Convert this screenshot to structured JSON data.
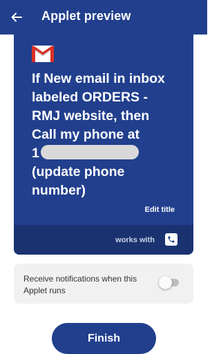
{
  "header": {
    "title": "Applet preview",
    "back_icon": "arrow-left-icon"
  },
  "card": {
    "service_icon": "gmail-icon",
    "title_lines": [
      "If New email in inbox",
      "labeled ORDERS -",
      "RMJ website, then",
      "Call my phone at",
      "1",
      "(update phone",
      "number)"
    ],
    "edit_title": "Edit title",
    "works_with": "works with",
    "works_with_icon": "phone-icon"
  },
  "notification": {
    "text": "Receive notifications when this Applet runs",
    "toggle_on": false
  },
  "finish_button": "Finish",
  "colors": {
    "primary": "#213f8d",
    "card_footer": "#1a3370",
    "notification_bg": "#f1f1f1"
  }
}
